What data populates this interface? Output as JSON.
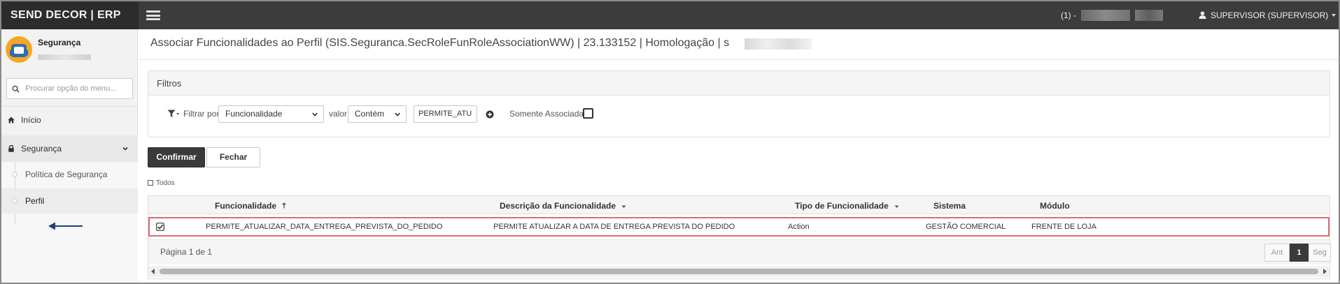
{
  "app": {
    "brand": "SEND DECOR | ERP",
    "company_prefix": "(1) -",
    "user_label": "SUPERVISOR (SUPERVISOR)"
  },
  "sidebar": {
    "module_title": "Segurança",
    "search_placeholder": "Procurar opção do menu...",
    "items": [
      {
        "label": "Início",
        "icon": "home-icon"
      },
      {
        "label": "Segurança",
        "icon": "lock-icon",
        "expanded": true
      }
    ],
    "subitems": [
      {
        "label": "Política de Segurança"
      },
      {
        "label": "Perfil",
        "active": true
      }
    ]
  },
  "page": {
    "title": "Associar Funcionalidades ao Perfil (SIS.Seguranca.SecRoleFunRoleAssociationWW) | 23.133152 | Homologação | s"
  },
  "filters": {
    "title": "Filtros",
    "filter_by_label": "Filtrar por",
    "filter_by_value": "Funcionalidade",
    "value_label": "valor",
    "operator_value": "Contém",
    "search_value": "PERMITE_ATU",
    "only_associated_label": "Somente Associadas"
  },
  "actions": {
    "confirm": "Confirmar",
    "close": "Fechar",
    "all": "Todos"
  },
  "grid": {
    "columns": [
      "Funcionalidade",
      "Descrição da Funcionalidade",
      "Tipo de Funcionalidade",
      "Sistema",
      "Módulo"
    ],
    "rows": [
      {
        "checked": true,
        "funcionalidade": "PERMITE_ATUALIZAR_DATA_ENTREGA_PREVISTA_DO_PEDIDO",
        "descricao": "PERMITE ATUALIZAR A DATA DE ENTREGA PREVISTA DO PEDIDO",
        "tipo": "Action",
        "sistema": "GESTÃO COMERCIAL",
        "modulo": "FRENTE DE LOJA"
      }
    ],
    "footer": {
      "page_info": "Página 1 de 1",
      "prev": "Ant",
      "current": "1",
      "next": "Seg"
    }
  },
  "colors": {
    "topbar": "#3c3c3c",
    "brand_bg": "#2c2c2c",
    "highlight_row_border": "#e06a74",
    "annotation_arrow": "#1f3f7a",
    "primary_button": "#3a3a3a"
  }
}
